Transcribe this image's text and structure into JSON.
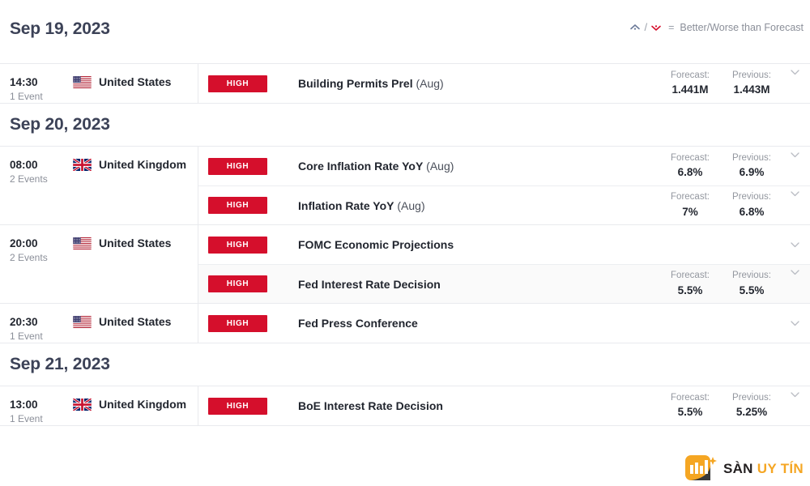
{
  "header": {
    "date": "Sep 19, 2023",
    "legend": {
      "up_icon": "arrow-up-better-icon",
      "separator": "/",
      "down_icon": "arrow-down-worse-icon",
      "equals": "=",
      "text": "Better/Worse than Forecast"
    }
  },
  "colors": {
    "impact_high": "#d50f2c",
    "heading_text": "#3c4257",
    "muted_text": "#8b8f99",
    "brand_orange": "#f5a623",
    "legend_up": "#6b7a99",
    "legend_down": "#d50f2c"
  },
  "value_labels": {
    "forecast": "Forecast:",
    "previous": "Previous:"
  },
  "days": [
    {
      "date": "Sep 19, 2023",
      "show_heading": false,
      "groups": [
        {
          "time": "14:30",
          "event_count": "1 Event",
          "country": "United States",
          "flag": "flag-us",
          "events": [
            {
              "impact": "HIGH",
              "title": "Building Permits Prel",
              "period": "(Aug)",
              "forecast": "1.441M",
              "previous": "1.443M",
              "has_values": true,
              "shaded": false,
              "expand_icon": "chevron-down-icon"
            }
          ]
        }
      ]
    },
    {
      "date": "Sep 20, 2023",
      "show_heading": true,
      "groups": [
        {
          "time": "08:00",
          "event_count": "2 Events",
          "country": "United Kingdom",
          "flag": "flag-uk",
          "events": [
            {
              "impact": "HIGH",
              "title": "Core Inflation Rate YoY",
              "period": "(Aug)",
              "forecast": "6.8%",
              "previous": "6.9%",
              "has_values": true,
              "shaded": false,
              "expand_icon": "chevron-down-icon"
            },
            {
              "impact": "HIGH",
              "title": "Inflation Rate YoY",
              "period": "(Aug)",
              "forecast": "7%",
              "previous": "6.8%",
              "has_values": true,
              "shaded": false,
              "expand_icon": "chevron-down-icon"
            }
          ]
        },
        {
          "time": "20:00",
          "event_count": "2 Events",
          "country": "United States",
          "flag": "flag-us",
          "events": [
            {
              "impact": "HIGH",
              "title": "FOMC Economic Projections",
              "period": "",
              "forecast": "",
              "previous": "",
              "has_values": false,
              "shaded": false,
              "expand_icon": "chevron-down-icon"
            },
            {
              "impact": "HIGH",
              "title": "Fed Interest Rate Decision",
              "period": "",
              "forecast": "5.5%",
              "previous": "5.5%",
              "has_values": true,
              "shaded": true,
              "expand_icon": "chevron-down-icon"
            }
          ]
        },
        {
          "time": "20:30",
          "event_count": "1 Event",
          "country": "United States",
          "flag": "flag-us",
          "events": [
            {
              "impact": "HIGH",
              "title": "Fed Press Conference",
              "period": "",
              "forecast": "",
              "previous": "",
              "has_values": false,
              "shaded": false,
              "expand_icon": "chevron-down-icon"
            }
          ]
        }
      ]
    },
    {
      "date": "Sep 21, 2023",
      "show_heading": true,
      "groups": [
        {
          "time": "13:00",
          "event_count": "1 Event",
          "country": "United Kingdom",
          "flag": "flag-uk",
          "events": [
            {
              "impact": "HIGH",
              "title": "BoE Interest Rate Decision",
              "period": "",
              "forecast": "5.5%",
              "previous": "5.25%",
              "has_values": true,
              "shaded": false,
              "expand_icon": "chevron-down-icon"
            }
          ]
        }
      ]
    }
  ],
  "watermark": {
    "logo_icon": "bar-chart-logo-icon",
    "text_primary": "SÀN",
    "text_accent": "UY TÍN"
  }
}
